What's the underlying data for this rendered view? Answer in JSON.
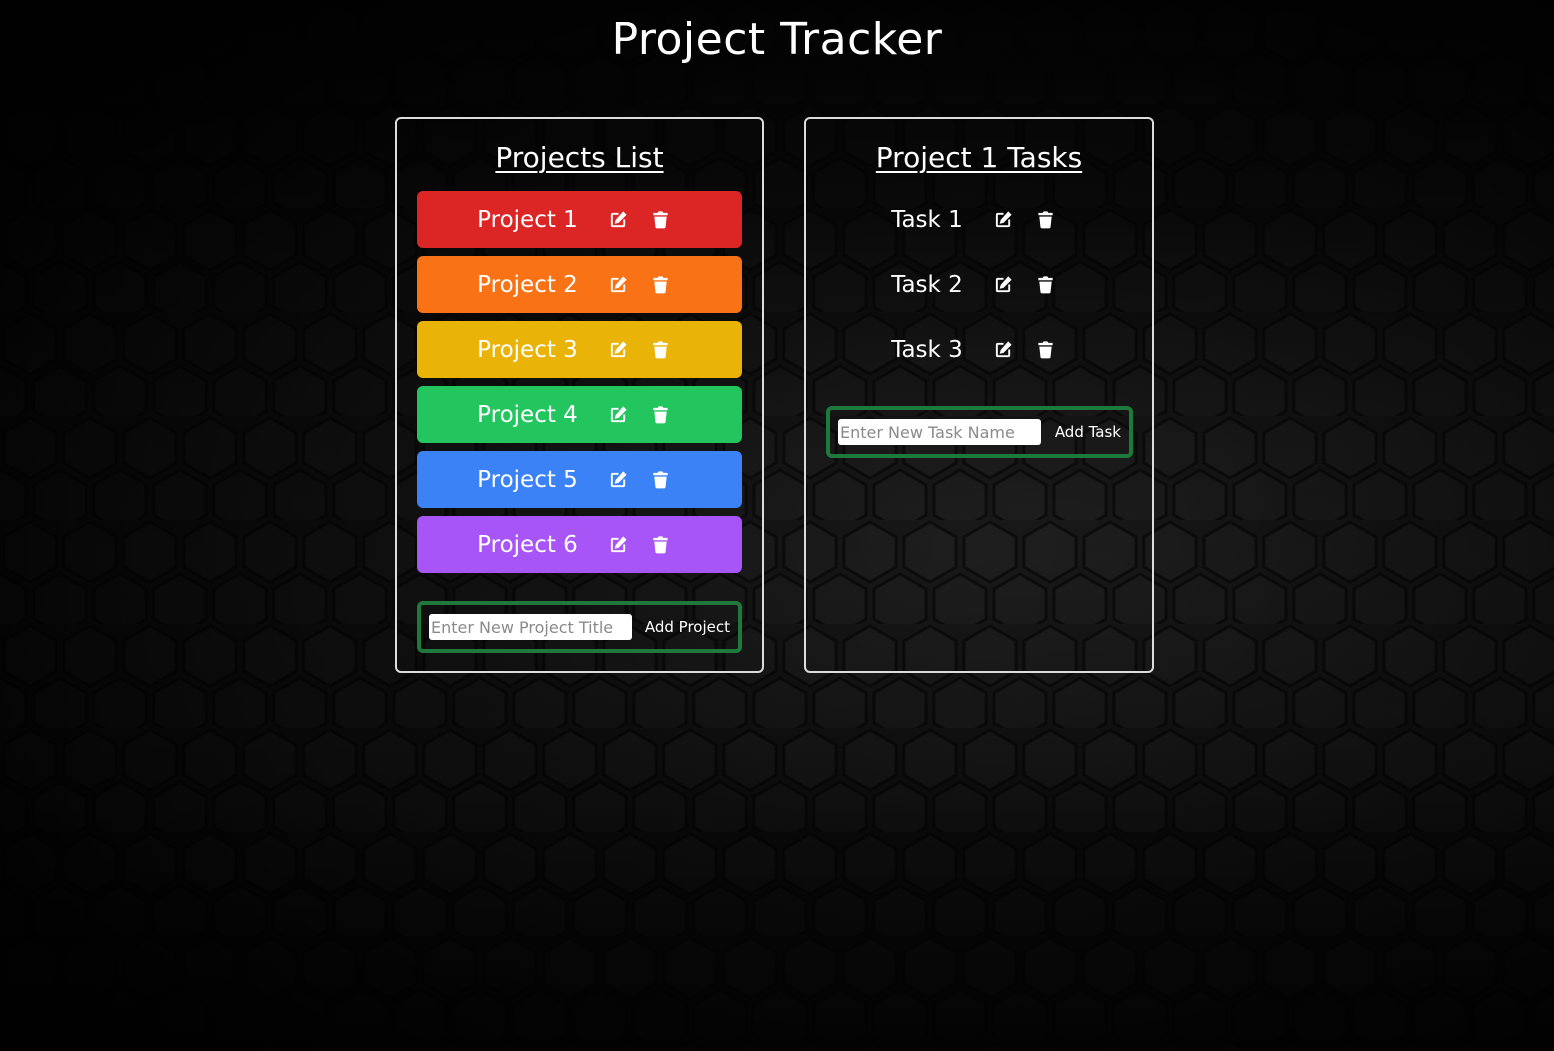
{
  "app": {
    "title": "Project Tracker"
  },
  "projects_panel": {
    "heading": "Projects List",
    "items": [
      {
        "label": "Project 1",
        "color": "#dc2626",
        "edit_icon": "edit-icon",
        "delete_icon": "trash-icon"
      },
      {
        "label": "Project 2",
        "color": "#f97316",
        "edit_icon": "edit-icon",
        "delete_icon": "trash-icon"
      },
      {
        "label": "Project 3",
        "color": "#eab308",
        "edit_icon": "edit-icon",
        "delete_icon": "trash-icon"
      },
      {
        "label": "Project 4",
        "color": "#22c55e",
        "edit_icon": "edit-icon",
        "delete_icon": "trash-icon"
      },
      {
        "label": "Project 5",
        "color": "#3b82f6",
        "edit_icon": "edit-icon",
        "delete_icon": "trash-icon"
      },
      {
        "label": "Project 6",
        "color": "#a855f7",
        "edit_icon": "edit-icon",
        "delete_icon": "trash-icon"
      }
    ],
    "add_form": {
      "placeholder": "Enter New Project Title",
      "value": "",
      "button_label": "Add Project"
    }
  },
  "tasks_panel": {
    "heading": "Project 1 Tasks",
    "items": [
      {
        "label": "Task 1",
        "edit_icon": "edit-icon",
        "delete_icon": "trash-icon"
      },
      {
        "label": "Task 2",
        "edit_icon": "edit-icon",
        "delete_icon": "trash-icon"
      },
      {
        "label": "Task 3",
        "edit_icon": "edit-icon",
        "delete_icon": "trash-icon"
      }
    ],
    "add_form": {
      "placeholder": "Enter New Task Name",
      "value": "",
      "button_label": "Add Task"
    }
  },
  "theme": {
    "form_border_color": "#1e7a3c",
    "panel_border_color": "#dcdcdc",
    "background_pattern": "dark-hexagon-pattern"
  }
}
